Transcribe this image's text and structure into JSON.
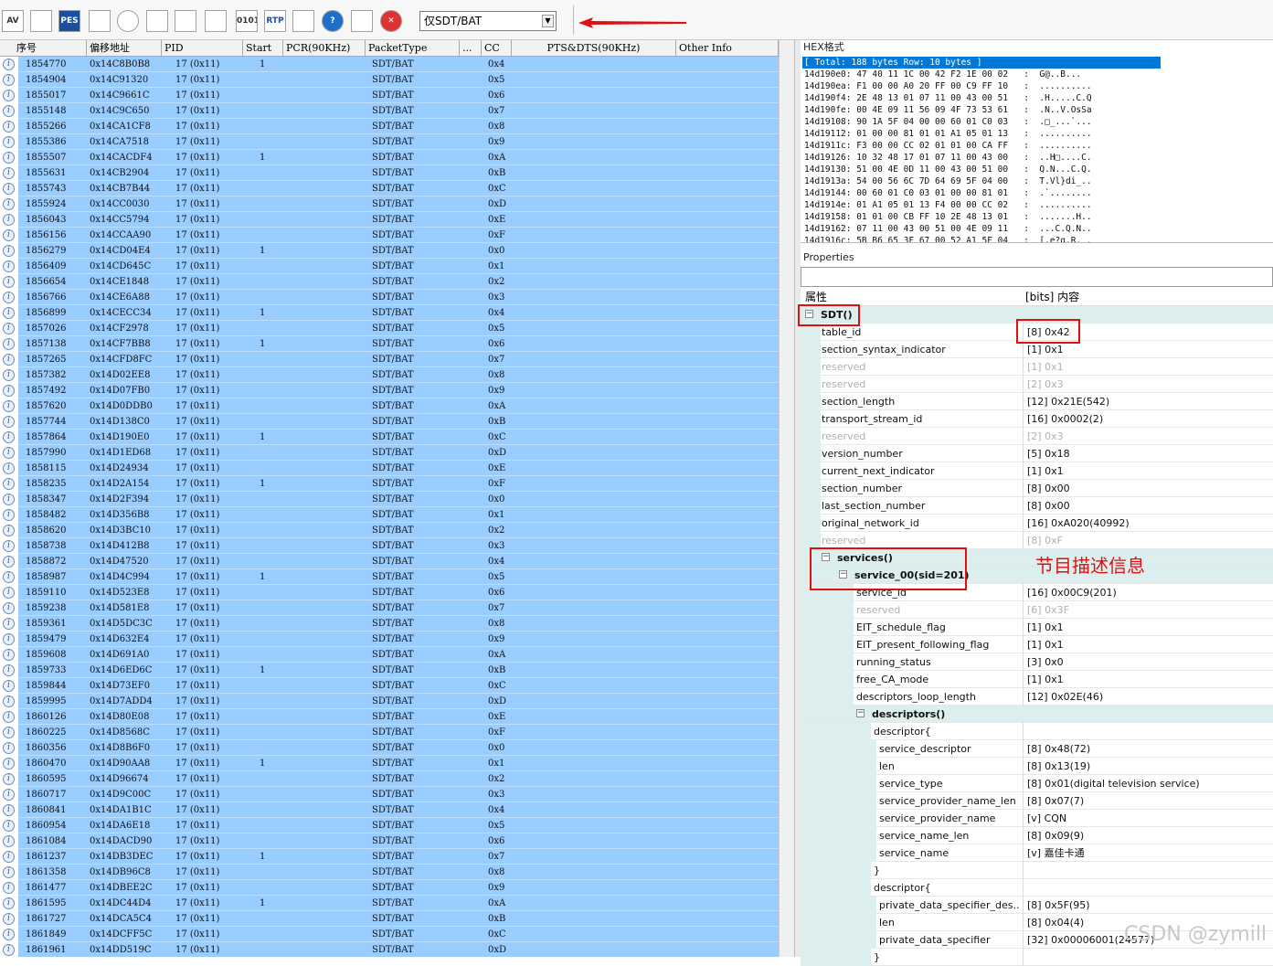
{
  "toolbar": {
    "buttons": [
      {
        "name": "av-button",
        "label": "AV",
        "icon": "av-icon"
      },
      {
        "name": "chart-button",
        "label": "",
        "icon": "chart-icon"
      },
      {
        "name": "pes-button",
        "label": "PES",
        "icon": "pes-icon"
      },
      {
        "name": "trend-button",
        "label": "",
        "icon": "trend-icon"
      },
      {
        "name": "clock-button",
        "label": "",
        "icon": "clock-icon"
      },
      {
        "name": "bars-button",
        "label": "",
        "icon": "bar-chart-icon"
      },
      {
        "name": "monitor-button",
        "label": "",
        "icon": "monitor-icon"
      },
      {
        "name": "warning-button",
        "label": "",
        "icon": "warning-icon"
      },
      {
        "name": "binary-button",
        "label": "0101",
        "icon": "binary-icon"
      },
      {
        "name": "rtp-button",
        "label": "RTP",
        "icon": "rtp-icon"
      },
      {
        "name": "export-button",
        "label": "",
        "icon": "export-icon"
      },
      {
        "name": "help-button",
        "label": "?",
        "icon": "help-icon"
      },
      {
        "name": "list-button",
        "label": "",
        "icon": "list-icon"
      },
      {
        "name": "close-button",
        "label": "✕",
        "icon": "close-icon"
      }
    ],
    "filter_value": "仅SDT/BAT"
  },
  "packet_list": {
    "columns": [
      "序号",
      "偏移地址",
      "PID",
      "Start",
      "PCR(90KHz)",
      "PacketType",
      "...",
      "CC",
      "PTS&DTS(90KHz)",
      "Other Info"
    ],
    "rows": [
      [
        "1854770",
        "0x14C8B0B8",
        "17  (0x11)",
        "1",
        "SDT/BAT",
        "0x4"
      ],
      [
        "1854904",
        "0x14C91320",
        "17  (0x11)",
        "",
        "SDT/BAT",
        "0x5"
      ],
      [
        "1855017",
        "0x14C9661C",
        "17  (0x11)",
        "",
        "SDT/BAT",
        "0x6"
      ],
      [
        "1855148",
        "0x14C9C650",
        "17  (0x11)",
        "",
        "SDT/BAT",
        "0x7"
      ],
      [
        "1855266",
        "0x14CA1CF8",
        "17  (0x11)",
        "",
        "SDT/BAT",
        "0x8"
      ],
      [
        "1855386",
        "0x14CA7518",
        "17  (0x11)",
        "",
        "SDT/BAT",
        "0x9"
      ],
      [
        "1855507",
        "0x14CACDF4",
        "17  (0x11)",
        "1",
        "SDT/BAT",
        "0xA"
      ],
      [
        "1855631",
        "0x14CB2904",
        "17  (0x11)",
        "",
        "SDT/BAT",
        "0xB"
      ],
      [
        "1855743",
        "0x14CB7B44",
        "17  (0x11)",
        "",
        "SDT/BAT",
        "0xC"
      ],
      [
        "1855924",
        "0x14CC0030",
        "17  (0x11)",
        "",
        "SDT/BAT",
        "0xD"
      ],
      [
        "1856043",
        "0x14CC5794",
        "17  (0x11)",
        "",
        "SDT/BAT",
        "0xE"
      ],
      [
        "1856156",
        "0x14CCAA90",
        "17  (0x11)",
        "",
        "SDT/BAT",
        "0xF"
      ],
      [
        "1856279",
        "0x14CD04E4",
        "17  (0x11)",
        "1",
        "SDT/BAT",
        "0x0"
      ],
      [
        "1856409",
        "0x14CD645C",
        "17  (0x11)",
        "",
        "SDT/BAT",
        "0x1"
      ],
      [
        "1856654",
        "0x14CE1848",
        "17  (0x11)",
        "",
        "SDT/BAT",
        "0x2"
      ],
      [
        "1856766",
        "0x14CE6A88",
        "17  (0x11)",
        "",
        "SDT/BAT",
        "0x3"
      ],
      [
        "1856899",
        "0x14CECC34",
        "17  (0x11)",
        "1",
        "SDT/BAT",
        "0x4"
      ],
      [
        "1857026",
        "0x14CF2978",
        "17  (0x11)",
        "",
        "SDT/BAT",
        "0x5"
      ],
      [
        "1857138",
        "0x14CF7BB8",
        "17  (0x11)",
        "1",
        "SDT/BAT",
        "0x6"
      ],
      [
        "1857265",
        "0x14CFD8FC",
        "17  (0x11)",
        "",
        "SDT/BAT",
        "0x7"
      ],
      [
        "1857382",
        "0x14D02EE8",
        "17  (0x11)",
        "",
        "SDT/BAT",
        "0x8"
      ],
      [
        "1857492",
        "0x14D07FB0",
        "17  (0x11)",
        "",
        "SDT/BAT",
        "0x9"
      ],
      [
        "1857620",
        "0x14D0DDB0",
        "17  (0x11)",
        "",
        "SDT/BAT",
        "0xA"
      ],
      [
        "1857744",
        "0x14D138C0",
        "17  (0x11)",
        "",
        "SDT/BAT",
        "0xB"
      ],
      [
        "1857864",
        "0x14D190E0",
        "17  (0x11)",
        "1",
        "SDT/BAT",
        "0xC"
      ],
      [
        "1857990",
        "0x14D1ED68",
        "17  (0x11)",
        "",
        "SDT/BAT",
        "0xD"
      ],
      [
        "1858115",
        "0x14D24934",
        "17  (0x11)",
        "",
        "SDT/BAT",
        "0xE"
      ],
      [
        "1858235",
        "0x14D2A154",
        "17  (0x11)",
        "1",
        "SDT/BAT",
        "0xF"
      ],
      [
        "1858347",
        "0x14D2F394",
        "17  (0x11)",
        "",
        "SDT/BAT",
        "0x0"
      ],
      [
        "1858482",
        "0x14D356B8",
        "17  (0x11)",
        "",
        "SDT/BAT",
        "0x1"
      ],
      [
        "1858620",
        "0x14D3BC10",
        "17  (0x11)",
        "",
        "SDT/BAT",
        "0x2"
      ],
      [
        "1858738",
        "0x14D412B8",
        "17  (0x11)",
        "",
        "SDT/BAT",
        "0x3"
      ],
      [
        "1858872",
        "0x14D47520",
        "17  (0x11)",
        "",
        "SDT/BAT",
        "0x4"
      ],
      [
        "1858987",
        "0x14D4C994",
        "17  (0x11)",
        "1",
        "SDT/BAT",
        "0x5"
      ],
      [
        "1859110",
        "0x14D523E8",
        "17  (0x11)",
        "",
        "SDT/BAT",
        "0x6"
      ],
      [
        "1859238",
        "0x14D581E8",
        "17  (0x11)",
        "",
        "SDT/BAT",
        "0x7"
      ],
      [
        "1859361",
        "0x14D5DC3C",
        "17  (0x11)",
        "",
        "SDT/BAT",
        "0x8"
      ],
      [
        "1859479",
        "0x14D632E4",
        "17  (0x11)",
        "",
        "SDT/BAT",
        "0x9"
      ],
      [
        "1859608",
        "0x14D691A0",
        "17  (0x11)",
        "",
        "SDT/BAT",
        "0xA"
      ],
      [
        "1859733",
        "0x14D6ED6C",
        "17  (0x11)",
        "1",
        "SDT/BAT",
        "0xB"
      ],
      [
        "1859844",
        "0x14D73EF0",
        "17  (0x11)",
        "",
        "SDT/BAT",
        "0xC"
      ],
      [
        "1859995",
        "0x14D7ADD4",
        "17  (0x11)",
        "",
        "SDT/BAT",
        "0xD"
      ],
      [
        "1860126",
        "0x14D80E08",
        "17  (0x11)",
        "",
        "SDT/BAT",
        "0xE"
      ],
      [
        "1860225",
        "0x14D8568C",
        "17  (0x11)",
        "",
        "SDT/BAT",
        "0xF"
      ],
      [
        "1860356",
        "0x14D8B6F0",
        "17  (0x11)",
        "",
        "SDT/BAT",
        "0x0"
      ],
      [
        "1860470",
        "0x14D90AA8",
        "17  (0x11)",
        "1",
        "SDT/BAT",
        "0x1"
      ],
      [
        "1860595",
        "0x14D96674",
        "17  (0x11)",
        "",
        "SDT/BAT",
        "0x2"
      ],
      [
        "1860717",
        "0x14D9C00C",
        "17  (0x11)",
        "",
        "SDT/BAT",
        "0x3"
      ],
      [
        "1860841",
        "0x14DA1B1C",
        "17  (0x11)",
        "",
        "SDT/BAT",
        "0x4"
      ],
      [
        "1860954",
        "0x14DA6E18",
        "17  (0x11)",
        "",
        "SDT/BAT",
        "0x5"
      ],
      [
        "1861084",
        "0x14DACD90",
        "17  (0x11)",
        "",
        "SDT/BAT",
        "0x6"
      ],
      [
        "1861237",
        "0x14DB3DEC",
        "17  (0x11)",
        "1",
        "SDT/BAT",
        "0x7"
      ],
      [
        "1861358",
        "0x14DB96C8",
        "17  (0x11)",
        "",
        "SDT/BAT",
        "0x8"
      ],
      [
        "1861477",
        "0x14DBEE2C",
        "17  (0x11)",
        "",
        "SDT/BAT",
        "0x9"
      ],
      [
        "1861595",
        "0x14DC44D4",
        "17  (0x11)",
        "1",
        "SDT/BAT",
        "0xA"
      ],
      [
        "1861727",
        "0x14DCA5C4",
        "17  (0x11)",
        "",
        "SDT/BAT",
        "0xB"
      ],
      [
        "1861849",
        "0x14DCFF5C",
        "17  (0x11)",
        "",
        "SDT/BAT",
        "0xC"
      ],
      [
        "1861961",
        "0x14DD519C",
        "17  (0x11)",
        "",
        "SDT/BAT",
        "0xD"
      ]
    ]
  },
  "hex": {
    "title": "HEX格式",
    "summary": "[ Total: 188 bytes  Row: 10 bytes ]",
    "lines": [
      "14d190e0: 47 40 11 1C 00 42 F2 1E 00 02   :  G@..B...",
      "14d190ea: F1 00 00 A0 20 FF 00 C9 FF 10   :  ..........",
      "14d190f4: 2E 48 13 01 07 11 00 43 00 51   :  .H.....C.Q",
      "14d190fe: 00 4E 09 11 56 09 4F 73 53 61   :  .N..V.OsSa",
      "14d19108: 90 1A 5F 04 00 00 60 01 C0 03   :  .□_...`...",
      "14d19112: 01 00 00 81 01 01 A1 05 01 13   :  ..........",
      "14d1911c: F3 00 00 CC 02 01 01 00 CA FF   :  ..........",
      "14d19126: 10 32 48 17 01 07 11 00 43 00   :  ..H□....C.",
      "14d19130: 51 00 4E 0D 11 00 43 00 51 00   :  Q.N...C.Q.",
      "14d1913a: 54 00 56 6C 7D 64 69 5F 04 00   :  T.Vl}di_..",
      "14d19144: 00 60 01 C0 03 01 00 00 81 01   :  .`........",
      "14d1914e: 01 A1 05 01 13 F4 00 00 CC 02   :  ..........",
      "14d19158: 01 01 00 CB FF 10 2E 48 13 01   :  .......H..",
      "14d19162: 07 11 00 43 00 51 00 4E 09 11   :  ...C.Q.N..",
      "14d1916c: 5B B6 65 3F 67 00 52 A1 5F 04   :  [.e?g.R._."
    ]
  },
  "properties": {
    "title": "Properties",
    "col_attr": "属性",
    "col_value": "[bits] 内容",
    "rows": [
      {
        "n": "SDT()",
        "v": "",
        "lvl": 0,
        "grp": true,
        "exp": "−"
      },
      {
        "n": "table_id",
        "v": "[8]  0x42",
        "lvl": 1
      },
      {
        "n": "section_syntax_indicator",
        "v": "[1]  0x1",
        "lvl": 1
      },
      {
        "n": "reserved",
        "v": "[1]  0x1",
        "lvl": 1,
        "dim": true
      },
      {
        "n": "reserved",
        "v": "[2]  0x3",
        "lvl": 1,
        "dim": true
      },
      {
        "n": "section_length",
        "v": "[12] 0x21E(542)",
        "lvl": 1
      },
      {
        "n": "transport_stream_id",
        "v": "[16] 0x0002(2)",
        "lvl": 1
      },
      {
        "n": "reserved",
        "v": "[2]  0x3",
        "lvl": 1,
        "dim": true
      },
      {
        "n": "version_number",
        "v": "[5]  0x18",
        "lvl": 1
      },
      {
        "n": "current_next_indicator",
        "v": "[1]  0x1",
        "lvl": 1
      },
      {
        "n": "section_number",
        "v": "[8]  0x00",
        "lvl": 1
      },
      {
        "n": "last_section_number",
        "v": "[8]  0x00",
        "lvl": 1
      },
      {
        "n": "original_network_id",
        "v": "[16] 0xA020(40992)",
        "lvl": 1
      },
      {
        "n": "reserved",
        "v": "[8]  0xF",
        "lvl": 1,
        "dim": true
      },
      {
        "n": "services()",
        "v": "",
        "lvl": 1,
        "grp": true,
        "exp": "−"
      },
      {
        "n": "service_00(sid=201)",
        "v": "",
        "lvl": 2,
        "grp": true,
        "exp": "−"
      },
      {
        "n": "service_id",
        "v": "[16] 0x00C9(201)",
        "lvl": 3
      },
      {
        "n": "reserved",
        "v": "[6]  0x3F",
        "lvl": 3,
        "dim": true
      },
      {
        "n": "EIT_schedule_flag",
        "v": "[1]  0x1",
        "lvl": 3
      },
      {
        "n": "EIT_present_following_flag",
        "v": "[1]  0x1",
        "lvl": 3
      },
      {
        "n": "running_status",
        "v": "[3]  0x0",
        "lvl": 3
      },
      {
        "n": "free_CA_mode",
        "v": "[1]  0x1",
        "lvl": 3
      },
      {
        "n": "descriptors_loop_length",
        "v": "[12] 0x02E(46)",
        "lvl": 3
      },
      {
        "n": "descriptors()",
        "v": "",
        "lvl": 3,
        "grp": true,
        "exp": "−"
      },
      {
        "n": "descriptor{",
        "v": "",
        "lvl": 4
      },
      {
        "n": "service_descriptor",
        "v": "[8]  0x48(72)",
        "lvl": 5
      },
      {
        "n": "len",
        "v": "[8]  0x13(19)",
        "lvl": 5
      },
      {
        "n": "service_type",
        "v": "[8]  0x01(digital television service)",
        "lvl": 5
      },
      {
        "n": "service_provider_name_len",
        "v": "[8]  0x07(7)",
        "lvl": 5
      },
      {
        "n": "service_provider_name",
        "v": "[v]  CQN",
        "lvl": 5
      },
      {
        "n": "service_name_len",
        "v": "[8]  0x09(9)",
        "lvl": 5
      },
      {
        "n": "service_name",
        "v": "[v]  嘉佳卡通",
        "lvl": 5
      },
      {
        "n": "}",
        "v": "",
        "lvl": 4
      },
      {
        "n": "descriptor{",
        "v": "",
        "lvl": 4
      },
      {
        "n": "private_data_specifier_des...",
        "v": "[8]  0x5F(95)",
        "lvl": 5
      },
      {
        "n": "len",
        "v": "[8]  0x04(4)",
        "lvl": 5
      },
      {
        "n": "private_data_specifier",
        "v": "[32] 0x00006001(24577)",
        "lvl": 5
      },
      {
        "n": "}",
        "v": "",
        "lvl": 4
      }
    ]
  },
  "annotation_text": "节目描述信息",
  "watermark": "CSDN @zymill"
}
